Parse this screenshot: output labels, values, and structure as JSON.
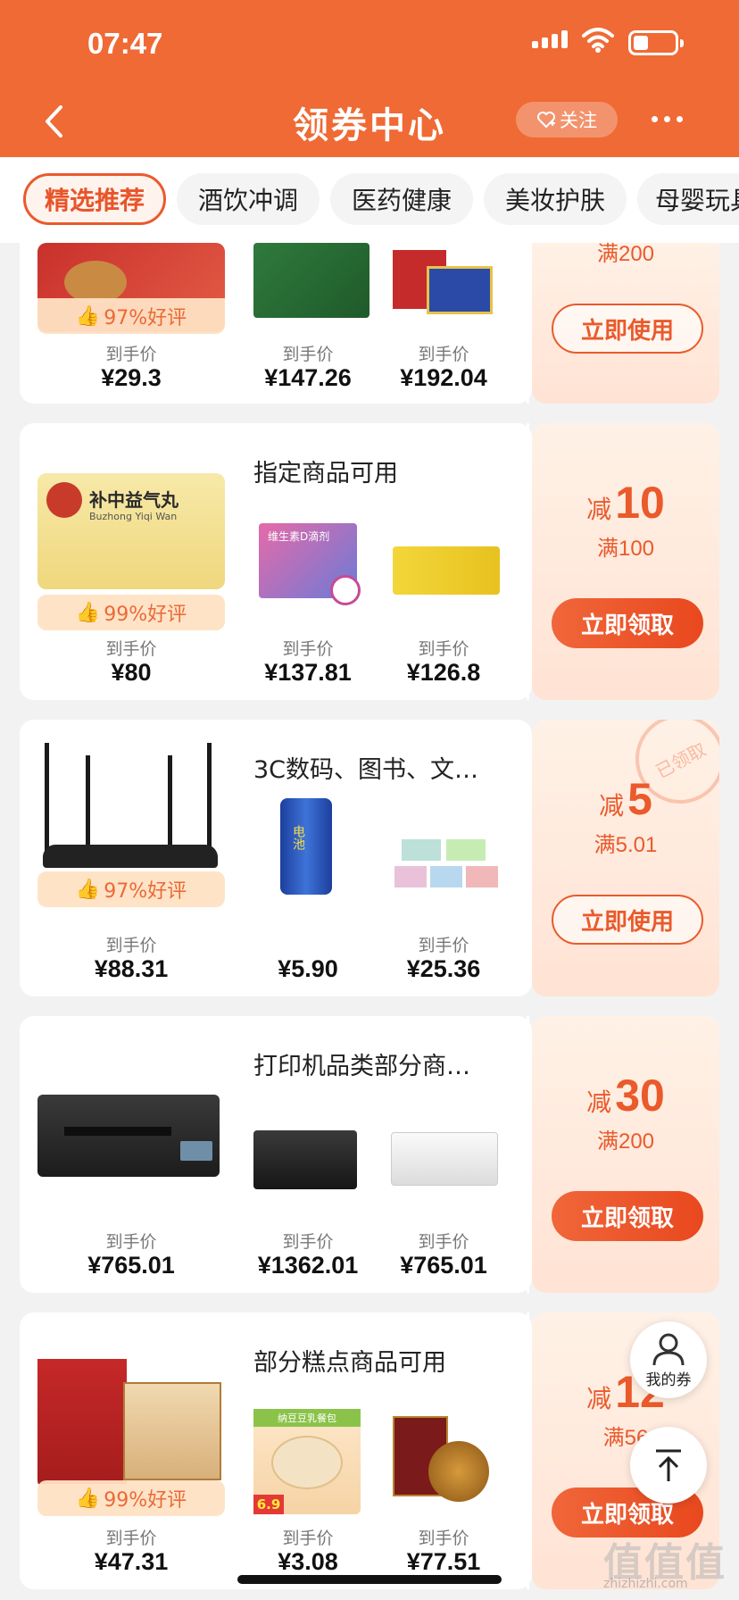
{
  "status": {
    "time": "07:47"
  },
  "header": {
    "title": "领券中心",
    "follow": "关注"
  },
  "tabs": [
    "精选推荐",
    "酒饮冲调",
    "医药健康",
    "美妆护肤",
    "母婴玩具"
  ],
  "common": {
    "price_label": "到手价"
  },
  "top_partial": {
    "min": "满200",
    "button": "立即使用",
    "rating": "97%好评",
    "prices": [
      "¥29.3",
      "¥147.26",
      "¥192.04"
    ]
  },
  "cards": [
    {
      "scope": "指定商品可用",
      "rating": "99%好评",
      "reduce_label": "减",
      "amount": "10",
      "min": "满100",
      "button": "立即领取",
      "prices": [
        "¥80",
        "¥137.81",
        "¥126.8"
      ]
    },
    {
      "scope": "3C数码、图书、文…",
      "rating": "97%好评",
      "reduce_label": "减",
      "amount": "5",
      "min": "满5.01",
      "button": "立即使用",
      "stamp": "已领取",
      "prices": [
        "¥88.31",
        "¥5.90",
        "¥25.36"
      ]
    },
    {
      "scope": "打印机品类部分商…",
      "reduce_label": "减",
      "amount": "30",
      "min": "满200",
      "button": "立即领取",
      "prices": [
        "¥765.01",
        "¥1362.01",
        "¥765.01"
      ]
    },
    {
      "scope": "部分糕点商品可用",
      "rating": "99%好评",
      "reduce_label": "减",
      "amount": "12",
      "min": "满56",
      "button": "立即领取",
      "prices": [
        "¥47.31",
        "¥3.08",
        "¥77.51"
      ]
    }
  ],
  "product_labels": {
    "pill_name": "补中益气丸",
    "pill_en": "Buzhong Yiqi Wan",
    "vitd": "维生素D滴剂",
    "battery": "电池",
    "doupao": "纳豆豆乳餐包",
    "doupao_price": "6.9"
  },
  "floating": {
    "my_coupons": "我的券"
  },
  "watermark": {
    "main": "值值值",
    "sub": "zhizhizhi.com"
  }
}
